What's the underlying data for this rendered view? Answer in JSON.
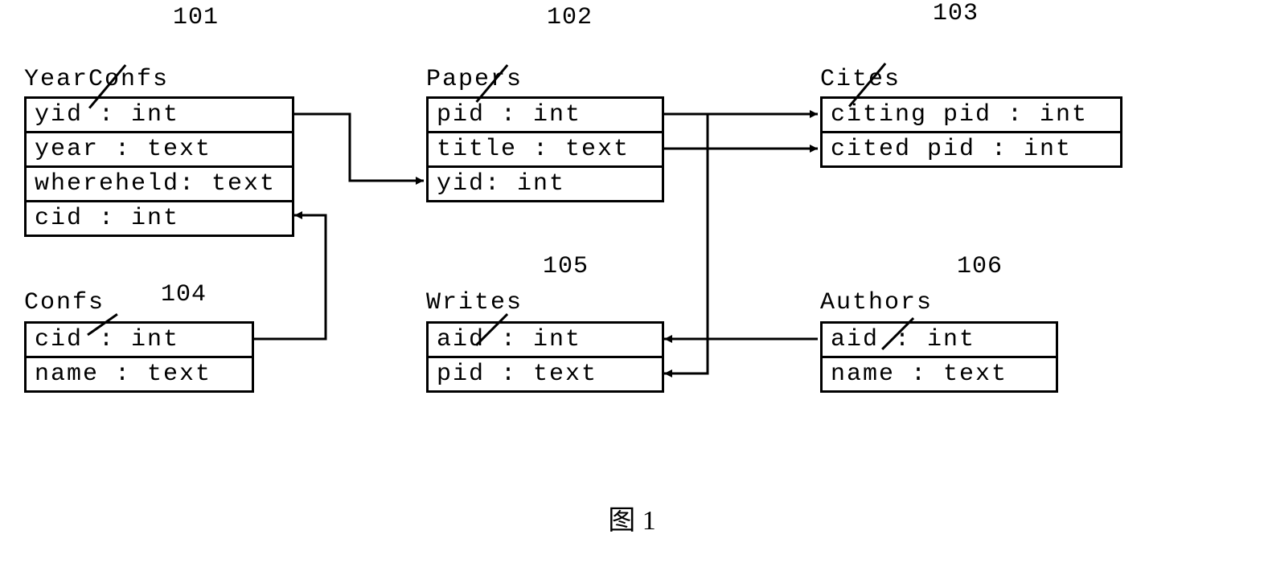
{
  "caption": "图 1",
  "entities": {
    "yearconfs": {
      "ref": "101",
      "title": "YearConfs",
      "fields": [
        "yid : int",
        "year : text",
        "whereheld: text",
        "cid : int"
      ]
    },
    "papers": {
      "ref": "102",
      "title": "Papers",
      "fields": [
        "pid : int",
        "title : text",
        "yid: int"
      ]
    },
    "cites": {
      "ref": "103",
      "title": "Cites",
      "fields": [
        "citing pid : int",
        "cited pid : int"
      ]
    },
    "confs": {
      "ref": "104",
      "title": "Confs",
      "fields": [
        "cid : int",
        "name : text"
      ]
    },
    "writes": {
      "ref": "105",
      "title": "Writes",
      "fields": [
        "aid : int",
        "pid : text"
      ]
    },
    "authors": {
      "ref": "106",
      "title": "Authors",
      "fields": [
        "aid : int",
        "name : text"
      ]
    }
  }
}
